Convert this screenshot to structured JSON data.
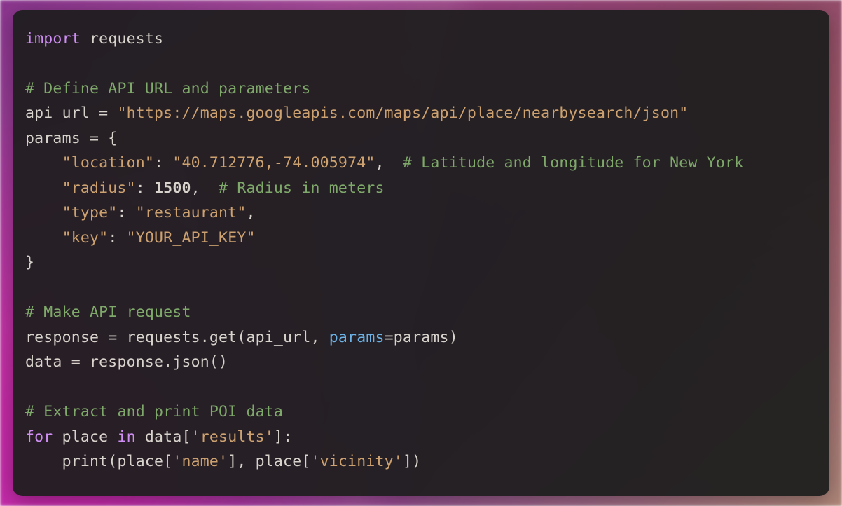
{
  "code": {
    "line1_import": "import",
    "line1_module": "requests",
    "line3_comment": "# Define API URL and parameters",
    "line4_var": "api_url",
    "line4_eq": " = ",
    "line4_str": "\"https://maps.googleapis.com/maps/api/place/nearbysearch/json\"",
    "line5_var": "params",
    "line5_rest": " = {",
    "line6_indent": "    ",
    "line6_key": "\"location\"",
    "line6_colon": ": ",
    "line6_val": "\"40.712776,-74.005974\"",
    "line6_comma": ",  ",
    "line6_comment": "# Latitude and longitude for New York",
    "line7_indent": "    ",
    "line7_key": "\"radius\"",
    "line7_colon": ": ",
    "line7_val": "1500",
    "line7_comma": ",  ",
    "line7_comment": "# Radius in meters",
    "line8_indent": "    ",
    "line8_key": "\"type\"",
    "line8_colon": ": ",
    "line8_val": "\"restaurant\"",
    "line8_comma": ",",
    "line9_indent": "    ",
    "line9_key": "\"key\"",
    "line9_colon": ": ",
    "line9_val": "\"YOUR_API_KEY\"",
    "line10_close": "}",
    "line12_comment": "# Make API request",
    "line13_a": "response = requests.get(api_url, ",
    "line13_kwarg": "params",
    "line13_b": "=params)",
    "line14": "data = response.json()",
    "line16_comment": "# Extract and print POI data",
    "line17_for": "for",
    "line17_a": " place ",
    "line17_in": "in",
    "line17_b": " data[",
    "line17_str": "'results'",
    "line17_c": "]:",
    "line18_indent": "    ",
    "line18_a": "print(place[",
    "line18_str1": "'name'",
    "line18_b": "], place[",
    "line18_str2": "'vicinity'",
    "line18_c": "])"
  }
}
